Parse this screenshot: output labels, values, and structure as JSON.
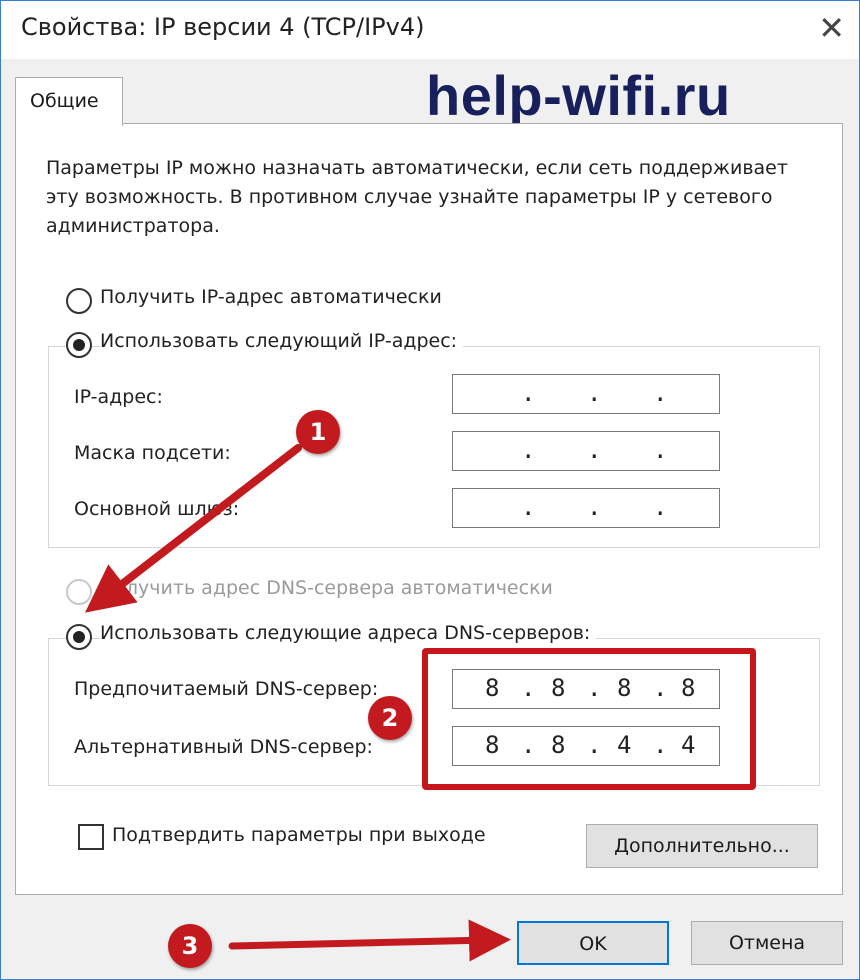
{
  "window": {
    "title": "Свойства: IP версии 4 (TCP/IPv4)",
    "close_glyph": "✕"
  },
  "tabs": [
    {
      "label": "Общие"
    }
  ],
  "watermark": "help-wifi.ru",
  "description": "Параметры IP можно назначать автоматически, если сеть поддерживает эту возможность. В противном случае узнайте параметры IP у сетевого администратора.",
  "ip_section": {
    "auto_label": "Получить IP-адрес автоматически",
    "manual_label": "Использовать следующий IP-адрес:",
    "fields": [
      {
        "label": "IP-адрес:",
        "value": [
          "",
          "",
          "",
          ""
        ]
      },
      {
        "label": "Маска подсети:",
        "value": [
          "",
          "",
          "",
          ""
        ]
      },
      {
        "label": "Основной шлюз:",
        "value": [
          "",
          "",
          "",
          ""
        ]
      }
    ]
  },
  "dns_section": {
    "auto_label": "Получить адрес DNS-сервера автоматически",
    "manual_label": "Использовать следующие адреса DNS-серверов:",
    "preferred": {
      "label": "Предпочитаемый DNS-сервер:",
      "value": [
        "8",
        "8",
        "8",
        "8"
      ]
    },
    "alternate": {
      "label": "Альтернативный DNS-сервер:",
      "value": [
        "8",
        "8",
        "4",
        "4"
      ]
    }
  },
  "validate": {
    "label": "Подтвердить параметры при выходе",
    "checked": false
  },
  "buttons": {
    "advanced": "Дополнительно...",
    "ok": "OK",
    "cancel": "Отмена"
  },
  "annotations": {
    "badges": [
      "1",
      "2",
      "3"
    ],
    "color": "#c21a1e"
  }
}
